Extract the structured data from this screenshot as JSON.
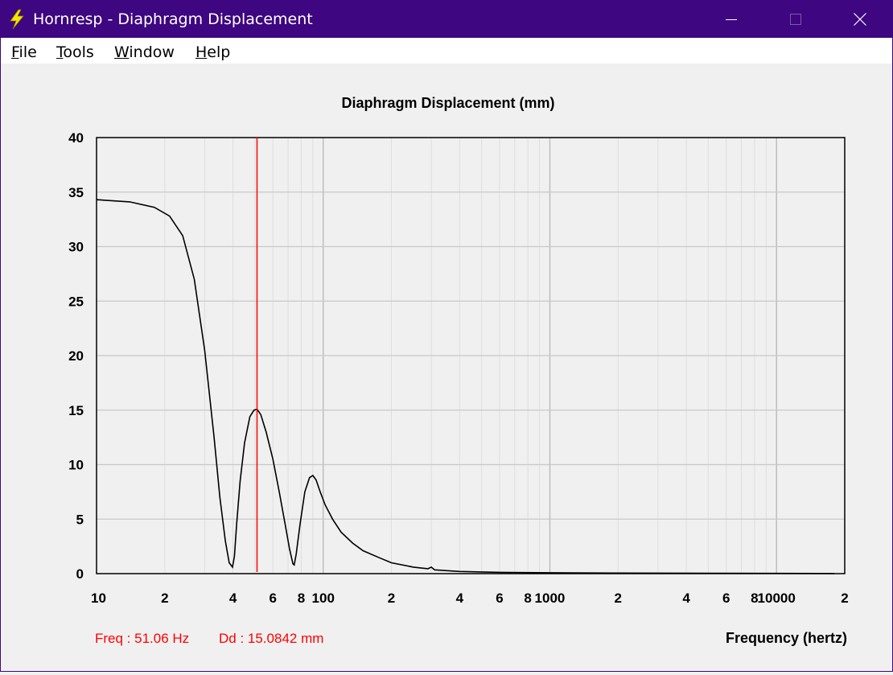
{
  "window": {
    "title": "Hornresp - Diaphragm Displacement",
    "titlebar_color": "#3e0680",
    "icon": "lightning-bolt-icon",
    "controls": [
      "minimize-icon",
      "maximize-icon",
      "close-icon"
    ]
  },
  "menu": {
    "items": [
      {
        "underline": "F",
        "rest": "ile"
      },
      {
        "underline": "T",
        "rest": "ools"
      },
      {
        "underline": "W",
        "rest": "indow"
      },
      {
        "underline": "H",
        "rest": "elp"
      }
    ]
  },
  "chart_data": {
    "type": "line",
    "title": "Diaphragm Displacement (mm)",
    "xlabel": "Frequency (hertz)",
    "ylabel": "",
    "x_scale": "log",
    "xlim": [
      10,
      20000
    ],
    "ylim": [
      0,
      40
    ],
    "yticks": [
      0,
      5,
      10,
      15,
      20,
      25,
      30,
      35,
      40
    ],
    "xticks": [
      {
        "value": 10,
        "label": "10"
      },
      {
        "value": 20,
        "label": "2"
      },
      {
        "value": 40,
        "label": "4"
      },
      {
        "value": 60,
        "label": "6"
      },
      {
        "value": 80,
        "label": "8"
      },
      {
        "value": 100,
        "label": "100"
      },
      {
        "value": 200,
        "label": "2"
      },
      {
        "value": 400,
        "label": "4"
      },
      {
        "value": 600,
        "label": "6"
      },
      {
        "value": 800,
        "label": "8"
      },
      {
        "value": 1000,
        "label": "1000"
      },
      {
        "value": 2000,
        "label": "2"
      },
      {
        "value": 4000,
        "label": "4"
      },
      {
        "value": 6000,
        "label": "6"
      },
      {
        "value": 8000,
        "label": "8"
      },
      {
        "value": 10000,
        "label": "10000"
      },
      {
        "value": 20000,
        "label": "2"
      }
    ],
    "grid": true,
    "line_color": "#000000",
    "cursor": {
      "x": 51.06,
      "color": "#ff0000"
    },
    "readout": {
      "freq": "Freq : 51.06 Hz",
      "dd": "Dd : 15.0842 mm",
      "color": "#ff0000"
    },
    "series": [
      {
        "x": [
          10,
          14,
          18,
          21,
          24,
          27,
          30,
          33,
          35,
          37,
          38.5,
          39.8,
          40.6,
          41.5,
          43,
          45,
          47.5,
          49.5,
          51.06,
          53,
          56,
          60,
          64,
          68,
          71,
          73.5,
          74.5,
          76,
          79,
          83,
          87,
          90,
          93,
          97,
          102,
          110,
          120,
          135,
          150,
          175,
          200,
          250,
          290,
          300,
          310,
          400,
          600,
          1000,
          2000,
          5000,
          10000,
          18000
        ],
        "y": [
          34.3,
          34.1,
          33.6,
          32.8,
          31.0,
          27.0,
          20.5,
          12.5,
          7.0,
          3.0,
          1.0,
          0.6,
          1.6,
          4.5,
          8.5,
          12.0,
          14.4,
          15.0,
          15.08,
          14.6,
          13.0,
          10.5,
          7.5,
          4.5,
          2.3,
          0.9,
          0.8,
          1.8,
          4.5,
          7.5,
          8.8,
          9.0,
          8.6,
          7.5,
          6.3,
          5.0,
          3.8,
          2.8,
          2.1,
          1.5,
          1.0,
          0.6,
          0.45,
          0.6,
          0.35,
          0.2,
          0.12,
          0.08,
          0.05,
          0.03,
          0.02,
          0.01
        ]
      }
    ]
  }
}
